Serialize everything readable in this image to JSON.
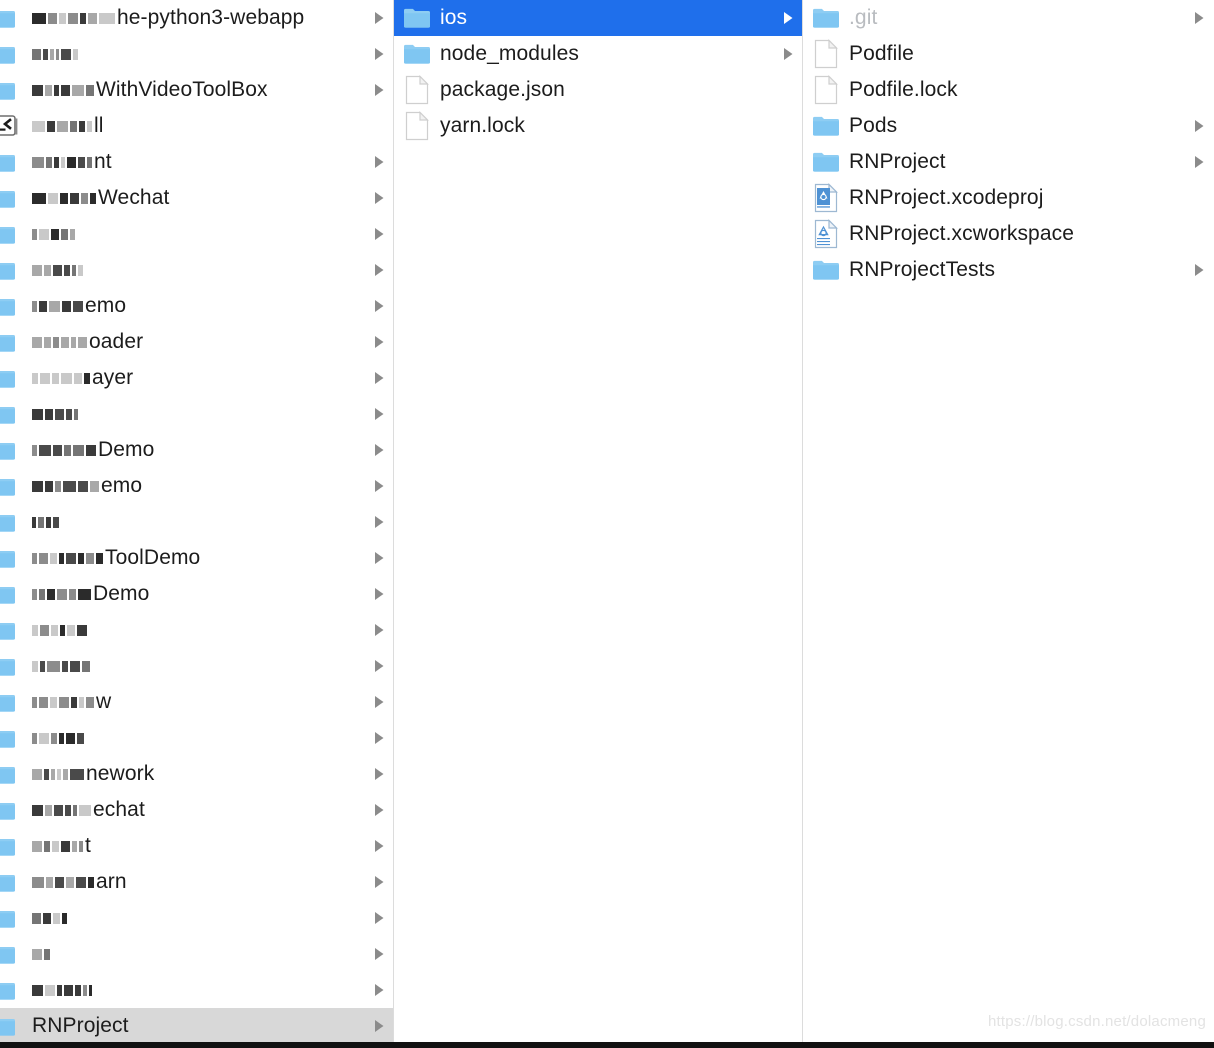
{
  "window": {
    "type": "finder-column-view",
    "accent_color": "#1f6feb",
    "inactive_selection_color": "#d8d8d8",
    "folder_icon_color": "#7fc6f2",
    "watermark": "https://blog.csdn.net/dolacmeng"
  },
  "columns": [
    {
      "id": "column-projects",
      "name": "projects-column",
      "items": [
        {
          "label": "he-python3-webapp",
          "censored": true,
          "censor_widths": [
            14,
            9,
            7,
            10,
            6,
            9,
            16
          ],
          "icon": "folder-icon",
          "disclosure": true,
          "state": "normal"
        },
        {
          "label": "",
          "censored": true,
          "censor_widths": [
            9,
            5,
            4,
            3,
            10,
            5
          ],
          "icon": "folder-icon",
          "disclosure": true,
          "state": "normal"
        },
        {
          "label": "WithVideoToolBox",
          "censored": true,
          "censor_widths": [
            11,
            7,
            5,
            9,
            12,
            8
          ],
          "icon": "folder-icon",
          "disclosure": true,
          "state": "normal"
        },
        {
          "label": "ll",
          "censored": true,
          "censor_widths": [
            13,
            8,
            11,
            7,
            6,
            5
          ],
          "icon": "shell-script-icon",
          "disclosure": false,
          "state": "normal"
        },
        {
          "label": "nt",
          "censored": true,
          "censor_widths": [
            12,
            6,
            5,
            4,
            9,
            7,
            5
          ],
          "icon": "folder-icon",
          "disclosure": true,
          "state": "normal"
        },
        {
          "label": "Wechat",
          "censored": true,
          "censor_widths": [
            14,
            10,
            8,
            9,
            7,
            6
          ],
          "icon": "folder-icon",
          "disclosure": true,
          "state": "normal"
        },
        {
          "label": "",
          "censored": true,
          "censor_widths": [
            5,
            10,
            8,
            7,
            5
          ],
          "icon": "folder-icon",
          "disclosure": true,
          "state": "normal"
        },
        {
          "label": "",
          "censored": true,
          "censor_widths": [
            10,
            7,
            9,
            6,
            4,
            5
          ],
          "icon": "folder-icon",
          "disclosure": true,
          "state": "normal"
        },
        {
          "label": "emo",
          "censored": true,
          "censor_widths": [
            5,
            8,
            11,
            9,
            10
          ],
          "icon": "folder-icon",
          "disclosure": true,
          "state": "normal"
        },
        {
          "label": "oader",
          "censored": true,
          "censor_widths": [
            10,
            7,
            6,
            8,
            5,
            9
          ],
          "icon": "folder-icon",
          "disclosure": true,
          "state": "normal"
        },
        {
          "label": "ayer",
          "censored": true,
          "censor_widths": [
            6,
            10,
            7,
            11,
            8,
            6
          ],
          "icon": "folder-icon",
          "disclosure": true,
          "state": "normal"
        },
        {
          "label": "",
          "censored": true,
          "censor_widths": [
            11,
            8,
            9,
            6,
            4
          ],
          "icon": "folder-icon",
          "disclosure": true,
          "state": "normal"
        },
        {
          "label": "Demo",
          "censored": true,
          "censor_widths": [
            5,
            12,
            9,
            7,
            11,
            10
          ],
          "icon": "folder-icon",
          "disclosure": true,
          "state": "normal"
        },
        {
          "label": "emo",
          "censored": true,
          "censor_widths": [
            11,
            8,
            6,
            13,
            10,
            9
          ],
          "icon": "folder-icon",
          "disclosure": true,
          "state": "normal"
        },
        {
          "label": "",
          "censored": true,
          "censor_widths": [
            4,
            6,
            5,
            6
          ],
          "icon": "folder-icon",
          "disclosure": true,
          "state": "normal"
        },
        {
          "label": "ToolDemo",
          "censored": true,
          "censor_widths": [
            5,
            9,
            7,
            5,
            10,
            6,
            8,
            7
          ],
          "icon": "folder-icon",
          "disclosure": true,
          "state": "normal"
        },
        {
          "label": "Demo",
          "censored": true,
          "censor_widths": [
            5,
            6,
            8,
            10,
            7,
            13
          ],
          "icon": "folder-icon",
          "disclosure": true,
          "state": "normal"
        },
        {
          "label": "",
          "censored": true,
          "censor_widths": [
            6,
            9,
            7,
            5,
            8,
            10
          ],
          "icon": "folder-icon",
          "disclosure": true,
          "state": "normal"
        },
        {
          "label": "",
          "censored": true,
          "censor_widths": [
            6,
            5,
            13,
            6,
            10,
            8
          ],
          "icon": "folder-icon",
          "disclosure": true,
          "state": "normal"
        },
        {
          "label": "w",
          "censored": true,
          "censor_widths": [
            5,
            9,
            7,
            10,
            6,
            5,
            8
          ],
          "icon": "folder-icon",
          "disclosure": true,
          "state": "normal"
        },
        {
          "label": "",
          "censored": true,
          "censor_widths": [
            5,
            10,
            6,
            5,
            9,
            7
          ],
          "icon": "folder-icon",
          "disclosure": true,
          "state": "normal"
        },
        {
          "label": "nework",
          "censored": true,
          "censor_widths": [
            10,
            5,
            4,
            4,
            5,
            14
          ],
          "icon": "folder-icon",
          "disclosure": true,
          "state": "normal"
        },
        {
          "label": "echat",
          "censored": true,
          "censor_widths": [
            11,
            7,
            9,
            6,
            4,
            12
          ],
          "icon": "folder-icon",
          "disclosure": true,
          "state": "normal"
        },
        {
          "label": "t",
          "censored": true,
          "censor_widths": [
            10,
            6,
            7,
            9,
            5,
            4
          ],
          "icon": "folder-icon",
          "disclosure": true,
          "state": "normal"
        },
        {
          "label": "arn",
          "censored": true,
          "censor_widths": [
            12,
            7,
            9,
            8,
            10,
            6
          ],
          "icon": "folder-icon",
          "disclosure": true,
          "state": "normal"
        },
        {
          "label": "",
          "censored": true,
          "censor_widths": [
            9,
            8,
            7,
            5
          ],
          "icon": "folder-icon",
          "disclosure": true,
          "state": "normal"
        },
        {
          "label": "",
          "censored": true,
          "censor_widths": [
            10,
            6
          ],
          "icon": "folder-icon",
          "disclosure": true,
          "state": "normal"
        },
        {
          "label": "",
          "censored": true,
          "censor_widths": [
            11,
            10,
            5,
            9,
            6,
            4,
            3
          ],
          "icon": "folder-icon",
          "disclosure": true,
          "state": "normal"
        },
        {
          "label": "RNProject",
          "censored": false,
          "icon": "folder-icon",
          "disclosure": true,
          "state": "selected-inactive"
        }
      ]
    },
    {
      "id": "column-rnproject",
      "name": "rnproject-column",
      "items": [
        {
          "label": "ios",
          "icon": "folder-icon",
          "disclosure": true,
          "state": "selected-active"
        },
        {
          "label": "node_modules",
          "icon": "folder-icon",
          "disclosure": true,
          "state": "normal"
        },
        {
          "label": "package.json",
          "icon": "file-icon",
          "disclosure": false,
          "state": "normal"
        },
        {
          "label": "yarn.lock",
          "icon": "file-icon",
          "disclosure": false,
          "state": "normal"
        }
      ]
    },
    {
      "id": "column-ios",
      "name": "ios-column",
      "items": [
        {
          "label": ".git",
          "icon": "folder-icon",
          "disclosure": true,
          "state": "dimmed"
        },
        {
          "label": "Podfile",
          "icon": "file-icon",
          "disclosure": false,
          "state": "normal"
        },
        {
          "label": "Podfile.lock",
          "icon": "file-icon",
          "disclosure": false,
          "state": "normal"
        },
        {
          "label": "Pods",
          "icon": "folder-icon",
          "disclosure": true,
          "state": "normal"
        },
        {
          "label": "RNProject",
          "icon": "folder-icon",
          "disclosure": true,
          "state": "normal"
        },
        {
          "label": "RNProject.xcodeproj",
          "icon": "xcodeproj-icon",
          "disclosure": false,
          "state": "normal"
        },
        {
          "label": "RNProject.xcworkspace",
          "icon": "xcworkspace-icon",
          "disclosure": false,
          "state": "normal"
        },
        {
          "label": "RNProjectTests",
          "icon": "folder-icon",
          "disclosure": true,
          "state": "normal"
        }
      ]
    }
  ]
}
